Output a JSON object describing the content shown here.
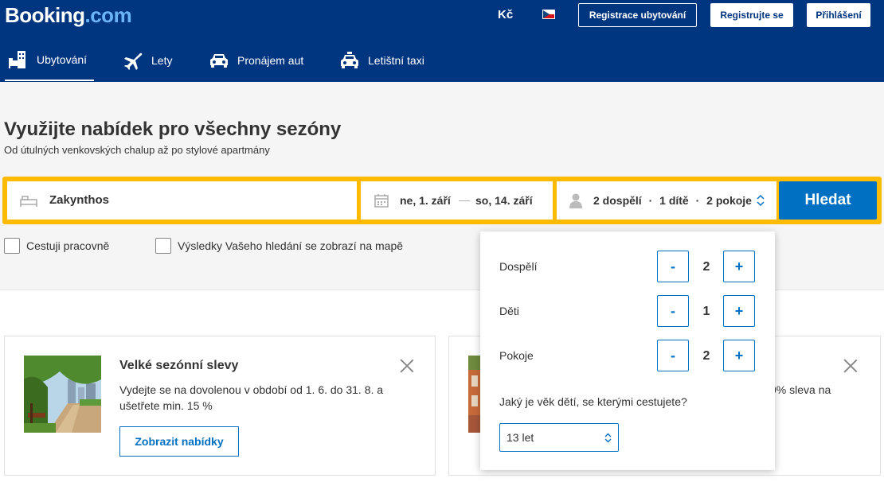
{
  "header": {
    "logo_main": "Booking",
    "logo_tld": ".com",
    "currency": "Kč",
    "language_flag": "czech-flag",
    "register_property_label": "Registrace ubytování",
    "register_label": "Registrujte se",
    "login_label": "Přihlášení"
  },
  "nav": {
    "items": [
      {
        "label": "Ubytování",
        "icon": "bed-building-icon",
        "active": true
      },
      {
        "label": "Lety",
        "icon": "airplane-icon",
        "active": false
      },
      {
        "label": "Pronájem aut",
        "icon": "car-icon",
        "active": false
      },
      {
        "label": "Letištní taxi",
        "icon": "taxi-icon",
        "active": false
      }
    ]
  },
  "hero": {
    "title": "Využijte nabídek pro všechny sezóny",
    "subtitle": "Od útulných venkovských chalup až po stylové apartmány"
  },
  "search": {
    "destination_value": "Zakynthos",
    "checkin": "ne, 1. září",
    "date_separator": "—",
    "checkout": "so, 14. září",
    "guests_adults": "2 dospělí",
    "guests_dot1": "·",
    "guests_children": "1 dítě",
    "guests_dot2": "·",
    "guests_rooms": "2 pokoje",
    "submit_label": "Hledat",
    "colors": {
      "bar": "#febb02",
      "button": "#0071c2"
    }
  },
  "options": {
    "business_label": "Cestuji pracovně",
    "map_label": "Výsledky Vašeho hledání se zobrazí na mapě"
  },
  "occupancy": {
    "adults_label": "Dospělí",
    "adults_value": "2",
    "children_label": "Děti",
    "children_value": "1",
    "rooms_label": "Pokoje",
    "rooms_value": "2",
    "minus_label": "-",
    "plus_label": "+",
    "age_question": "Jaký je věk dětí, se kterými cestujete?",
    "age_selected": "13 let"
  },
  "cards": [
    {
      "title": "Velké sezónní slevy",
      "text_line1": "Vydejte se na dovolenou v období od 1. 6. do 31. 8. a",
      "text_line2": "ušetřete min. 15 %",
      "button_label": "Zobrazit nabídky"
    },
    {
      "text_visible": "0% sleva na"
    }
  ]
}
